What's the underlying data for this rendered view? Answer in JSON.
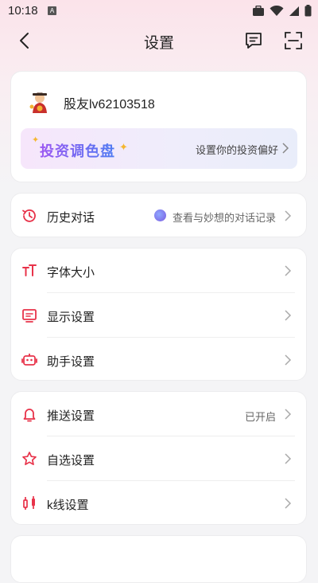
{
  "status_bar": {
    "time": "10:18",
    "a_badge": "A"
  },
  "header": {
    "title": "设置",
    "icons": [
      "back-arrow-icon",
      "message-icon",
      "scan-icon"
    ]
  },
  "profile": {
    "username": "股友lv62103518",
    "banner": {
      "title": "投资调色盘",
      "action": "设置你的投资偏好"
    }
  },
  "history": {
    "label": "历史对话",
    "value": "查看与妙想的对话记录"
  },
  "group1": [
    {
      "label": "字体大小",
      "icon": "font-size-icon"
    },
    {
      "label": "显示设置",
      "icon": "display-icon"
    },
    {
      "label": "助手设置",
      "icon": "robot-icon"
    }
  ],
  "group2": [
    {
      "label": "推送设置",
      "value": "已开启",
      "icon": "bell-icon"
    },
    {
      "label": "自选设置",
      "icon": "star-icon"
    },
    {
      "label": "k线设置",
      "icon": "candlestick-icon"
    }
  ],
  "colors": {
    "accent": "#e8334a",
    "banner_purple": "#7a5bf0"
  }
}
